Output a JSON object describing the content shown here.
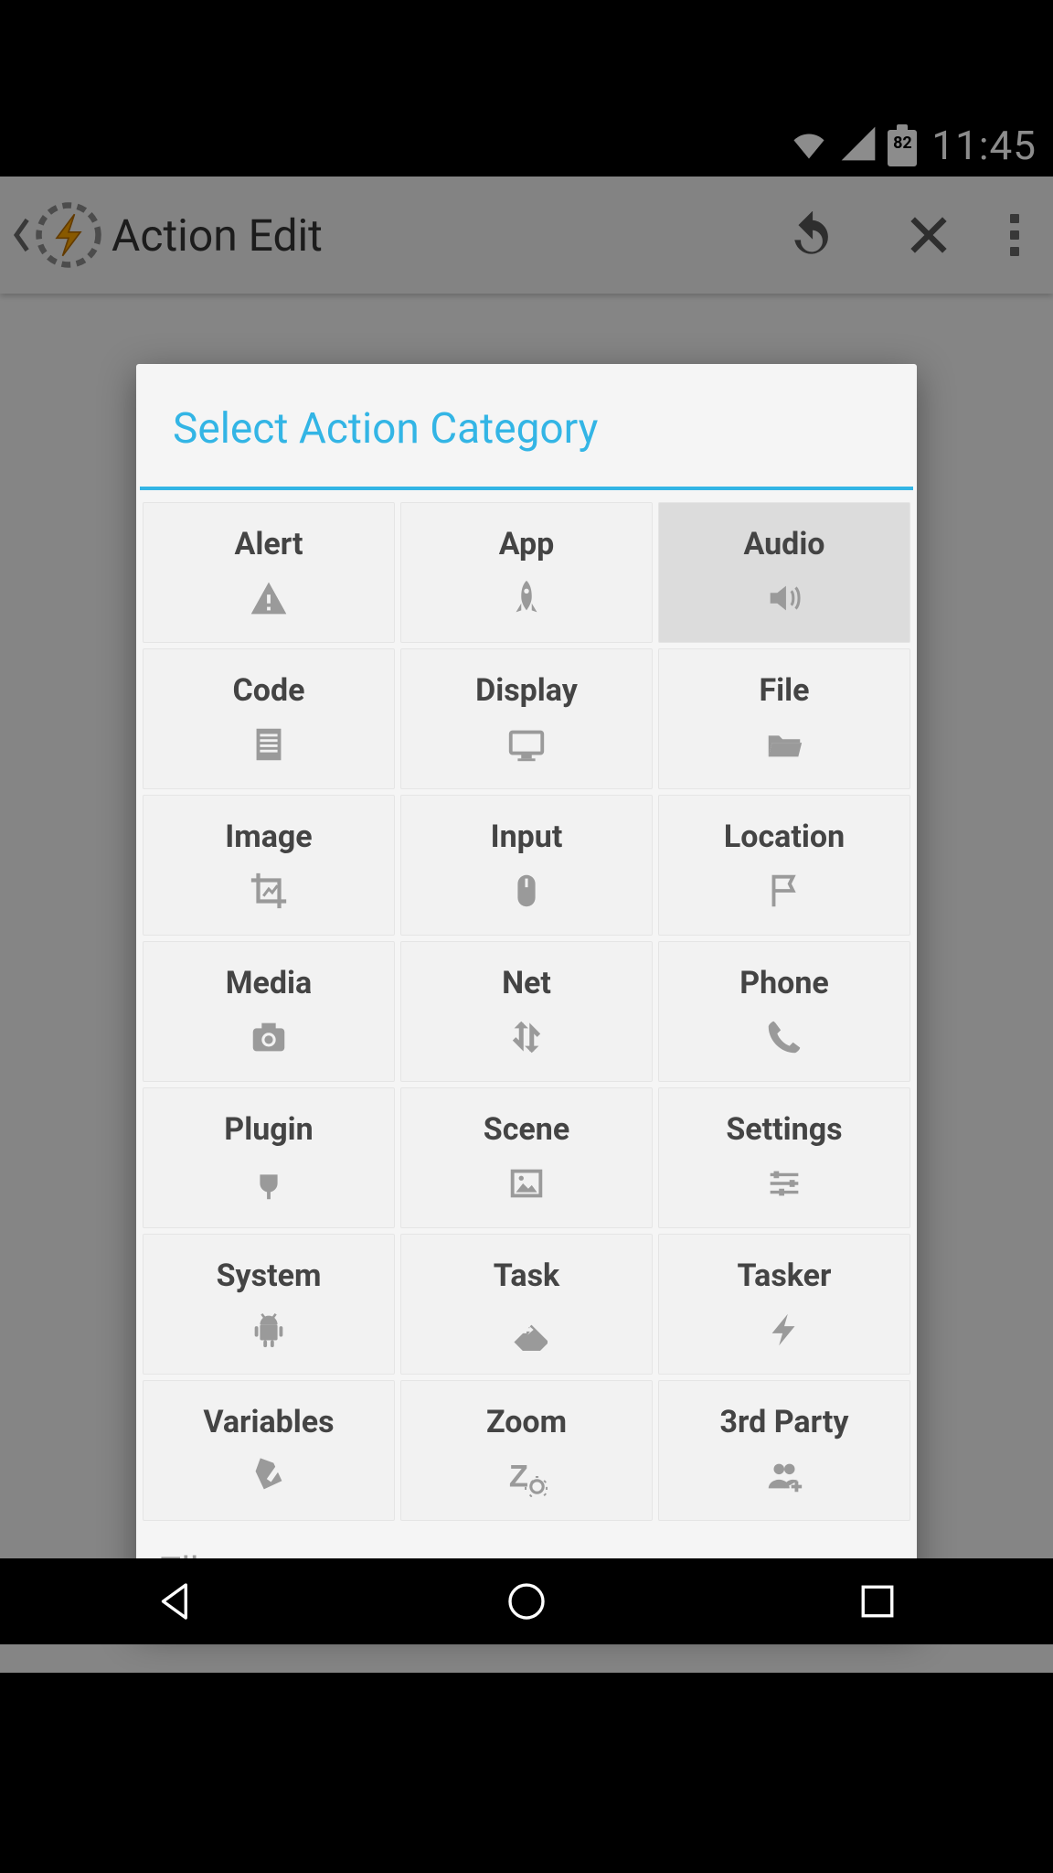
{
  "status": {
    "time": "11:45",
    "battery_pct": "82"
  },
  "header": {
    "title": "Action Edit"
  },
  "dialog": {
    "title": "Select Action Category",
    "filter_placeholder": "Filter",
    "selected_index": 2,
    "categories": [
      {
        "label": "Alert",
        "icon": "alert-triangle-icon"
      },
      {
        "label": "App",
        "icon": "rocket-icon"
      },
      {
        "label": "Audio",
        "icon": "speaker-icon"
      },
      {
        "label": "Code",
        "icon": "document-lines-icon"
      },
      {
        "label": "Display",
        "icon": "monitor-icon"
      },
      {
        "label": "File",
        "icon": "folder-open-icon"
      },
      {
        "label": "Image",
        "icon": "crop-image-icon"
      },
      {
        "label": "Input",
        "icon": "mouse-icon"
      },
      {
        "label": "Location",
        "icon": "flag-icon"
      },
      {
        "label": "Media",
        "icon": "camera-icon"
      },
      {
        "label": "Net",
        "icon": "transfer-arrows-icon"
      },
      {
        "label": "Phone",
        "icon": "phone-handset-icon"
      },
      {
        "label": "Plugin",
        "icon": "plug-icon"
      },
      {
        "label": "Scene",
        "icon": "picture-icon"
      },
      {
        "label": "Settings",
        "icon": "sliders-icon"
      },
      {
        "label": "System",
        "icon": "android-icon"
      },
      {
        "label": "Task",
        "icon": "directions-icon"
      },
      {
        "label": "Tasker",
        "icon": "lightning-icon"
      },
      {
        "label": "Variables",
        "icon": "tag-pencil-icon"
      },
      {
        "label": "Zoom",
        "icon": "zoom-gear-icon"
      },
      {
        "label": "3rd Party",
        "icon": "group-add-icon"
      }
    ]
  }
}
